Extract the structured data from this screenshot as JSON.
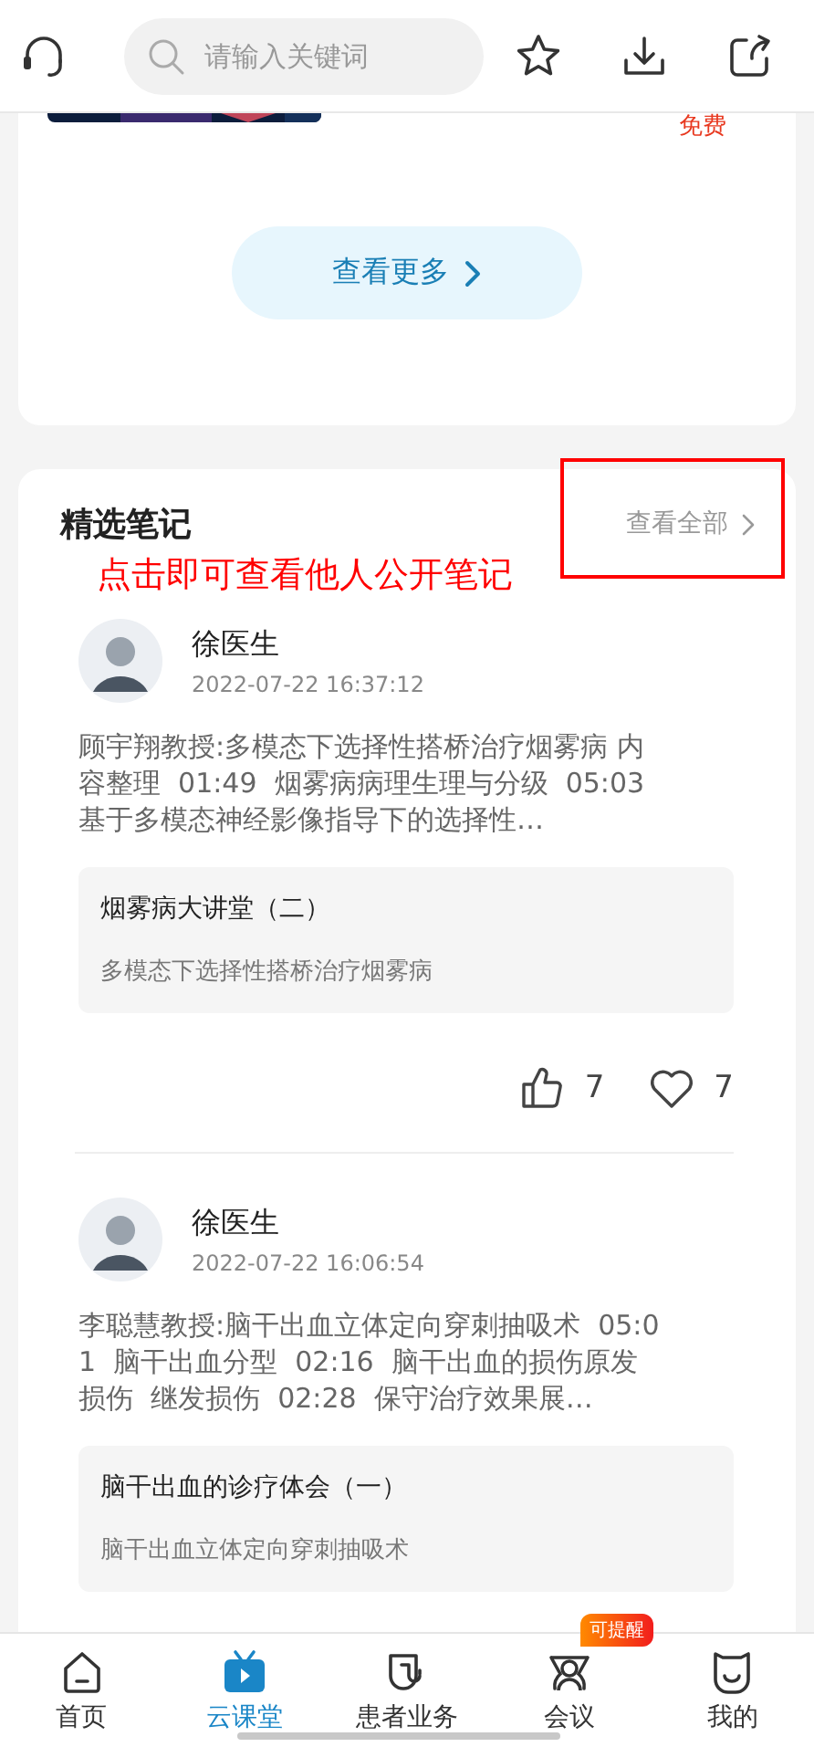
{
  "header": {
    "search": {
      "placeholder": "请输入关键词"
    }
  },
  "top_card": {
    "price": "免费",
    "more_button": "查看更多"
  },
  "notes_section": {
    "title": "精选笔记",
    "view_all": "查看全部",
    "annotation": "点击即可查看他人公开笔记",
    "notes": [
      {
        "author": "徐医生",
        "time": "2022-07-22 16:37:12",
        "text": "顾宇翔教授:多模态下选择性搭桥治疗烟雾病 内容整理  01:49  烟雾病病理生理与分级  05:03  基于多模态神经影像指导下的选择性…",
        "course": {
          "title": "烟雾病大讲堂（二）",
          "subtitle": "多模态下选择性搭桥治疗烟雾病"
        },
        "likes": "7",
        "favorites": "7"
      },
      {
        "author": "徐医生",
        "time": "2022-07-22 16:06:54",
        "text": "李聪慧教授:脑干出血立体定向穿刺抽吸术  05:01  脑干出血分型  02:16  脑干出血的损伤原发损伤  继发损伤  02:28  保守治疗效果展…",
        "course": {
          "title": "脑干出血的诊疗体会（一）",
          "subtitle": "脑干出血立体定向穿刺抽吸术"
        }
      }
    ]
  },
  "tab_bar": {
    "tabs": [
      {
        "kind": "home",
        "label": "首页",
        "selected": false
      },
      {
        "kind": "tv",
        "label": "云课堂",
        "selected": true
      },
      {
        "kind": "shield",
        "label": "患者业务",
        "selected": false
      },
      {
        "kind": "people",
        "label": "会议",
        "selected": false,
        "badge": "可提醒"
      },
      {
        "kind": "face",
        "label": "我的",
        "selected": false
      }
    ]
  }
}
